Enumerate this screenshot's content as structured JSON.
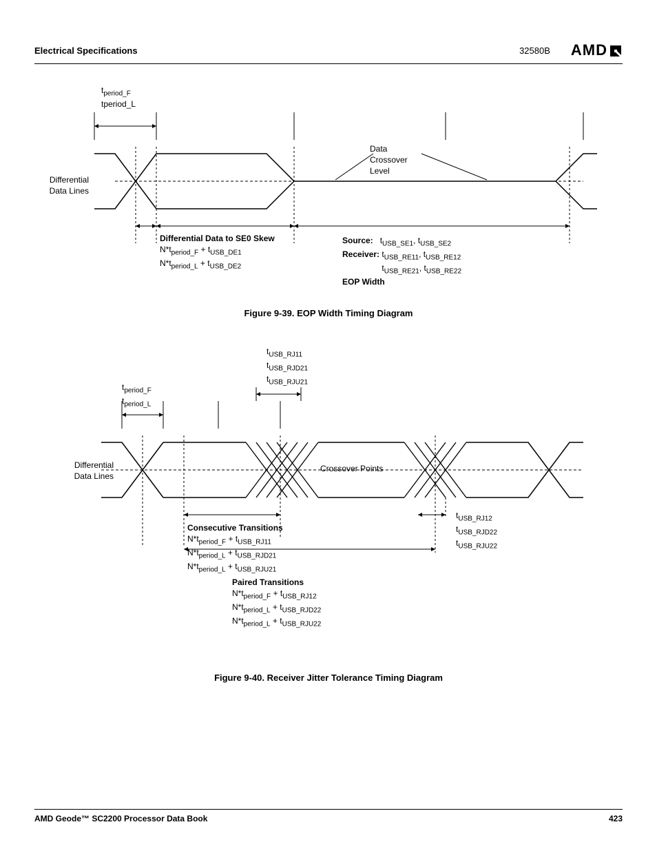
{
  "header": {
    "section": "Electrical Specifications",
    "docnum": "32580B",
    "logo": "AMD"
  },
  "fig1": {
    "top_labels": [
      "t",
      "period_F",
      "tperiod_L"
    ],
    "diff_label": "Differential\nData Lines",
    "crossover_label": "Data\nCrossover\nLevel",
    "skew_title": "Differential Data to SE0 Skew",
    "skew_lines": [
      "N*t",
      "period_F",
      " + t",
      "USB_DE1",
      "N*t",
      "period_L",
      " + t",
      "USB_DE2"
    ],
    "source_label": "Source:",
    "source_vals": [
      "t",
      "USB_SE1",
      ", t",
      "USB_SE2"
    ],
    "receiver_label": "Receiver:",
    "receiver_vals1": [
      "t",
      "USB_RE11",
      ", t",
      "USB_RE12"
    ],
    "receiver_vals2": [
      "t",
      "USB_RE21",
      ", t",
      "USB_RE22"
    ],
    "eop_label": "EOP Width",
    "caption": "Figure 9-39.  EOP Width Timing Diagram"
  },
  "fig2": {
    "top_vals": [
      "t",
      "USB_RJ11",
      "t",
      "USB_RJD21",
      "t",
      "USB_RJU21"
    ],
    "period_labels": [
      "t",
      "period_F",
      "t",
      "period_L"
    ],
    "diff_label": "Differential\nData Lines",
    "crossover_label": "Crossover Points",
    "right_vals": [
      "t",
      "USB_RJ12",
      "t",
      "USB_RJD22",
      "t",
      "USB_RJU22"
    ],
    "consec_title": "Consecutive Transitions",
    "consec_lines": [
      [
        "N*t",
        "period_F",
        " + t",
        "USB_RJ11"
      ],
      [
        "N*t",
        "period_L",
        " + t",
        "USB_RJD21"
      ],
      [
        "N*t",
        "period_L",
        " + t",
        "USB_RJU21"
      ]
    ],
    "paired_title": "Paired Transitions",
    "paired_lines": [
      [
        "N*t",
        "period_F",
        " + t",
        "USB_RJ12"
      ],
      [
        "N*t",
        "period_L",
        " + t",
        "USB_RJD22"
      ],
      [
        "N*t",
        "period_L",
        " + t",
        "USB_RJU22"
      ]
    ],
    "caption": "Figure 9-40.  Receiver Jitter Tolerance Timing Diagram"
  },
  "footer": {
    "left": "AMD Geode™ SC2200  Processor Data Book",
    "right": "423"
  }
}
